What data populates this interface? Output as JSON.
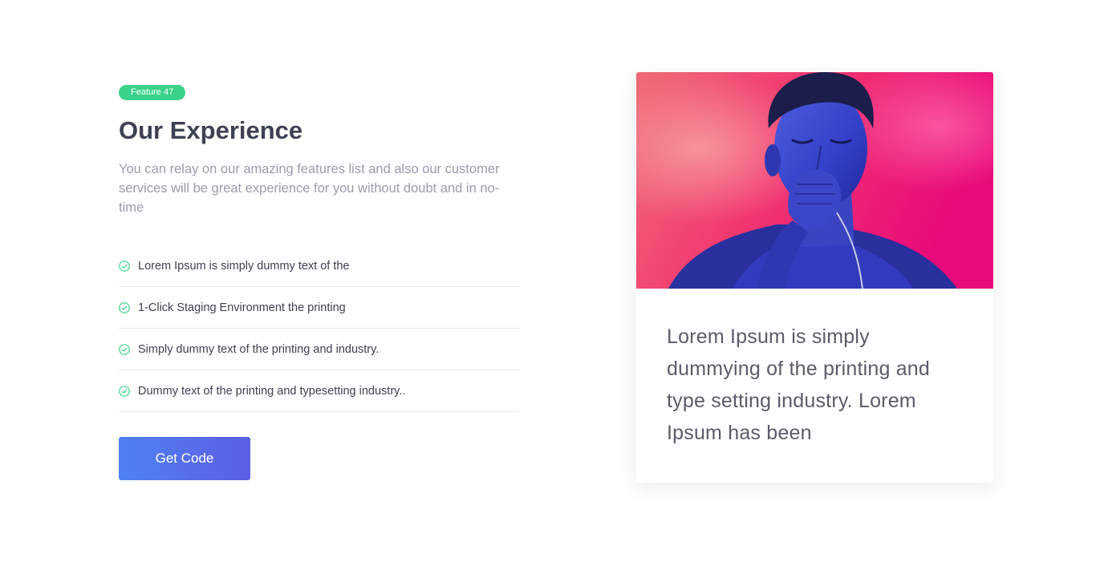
{
  "badge": "Feature 47",
  "title": "Our Experience",
  "description": "You can relay on our amazing features list and also our customer services will be great experience for you without doubt and in no-time",
  "features": [
    {
      "icon": "check-circle-icon",
      "text": "Lorem Ipsum is simply dummy text of the"
    },
    {
      "icon": "check-circle-icon",
      "text": "1-Click Staging Environment the printing"
    },
    {
      "icon": "check-circle-icon",
      "text": "Simply dummy text of the printing and industry."
    },
    {
      "icon": "check-circle-icon",
      "text": "Dummy text of the printing and typesetting industry.."
    }
  ],
  "button_label": "Get Code",
  "card": {
    "text": "Lorem Ipsum is simply dummying of the printing and type setting industry. Lorem Ipsum has been"
  },
  "colors": {
    "badge": "#3ad28a",
    "check": "#3ad28a",
    "button_start": "#4f82f3",
    "button_end": "#5c5ee4",
    "heading": "#3e4152",
    "muted": "#9a9cad"
  }
}
